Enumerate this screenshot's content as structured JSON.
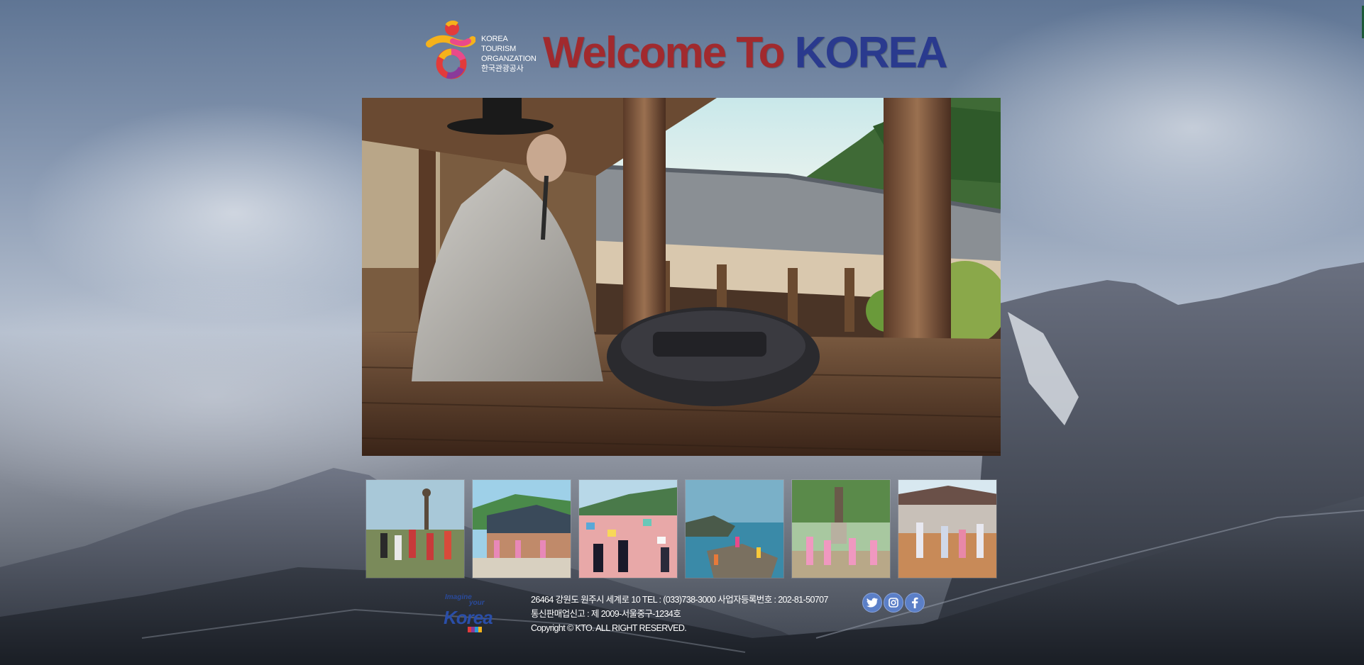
{
  "header": {
    "kto_lines": [
      "KOREA",
      "TOURISM",
      "ORGANZATION",
      "한국관광공사"
    ],
    "title_part1": "Welcome To ",
    "title_part2": "KOREA"
  },
  "video": {
    "scene": "traditional hanok pavilion with elder and boombox"
  },
  "thumbnails": [
    {
      "scene": "dancers at statue plaza"
    },
    {
      "scene": "dancers at traditional palace"
    },
    {
      "scene": "dancers at colorful hillside village"
    },
    {
      "scene": "people on coastal rocks"
    },
    {
      "scene": "pink dancers at statue park"
    },
    {
      "scene": "dancers in traditional courtyard"
    }
  ],
  "footer": {
    "iyk_small_1": "Imagine",
    "iyk_small_2": "your",
    "iyk_big": "Korea",
    "address_line": "26464 강원도 원주시 세계로 10 TEL : (033)738-3000 사업자등록번호 : 202-81-50707",
    "license_line": "통신판매업신고 : 제 2009-서울중구-1234호",
    "copyright_line": "Copyright © KTO. ALL RIGHT RESERVED."
  },
  "social": [
    {
      "name": "twitter-icon"
    },
    {
      "name": "instagram-icon"
    },
    {
      "name": "facebook-icon"
    }
  ],
  "colors": {
    "title_red": "#a12a2e",
    "title_blue": "#2a3a8e",
    "social_blue": "#5b7fc7"
  }
}
